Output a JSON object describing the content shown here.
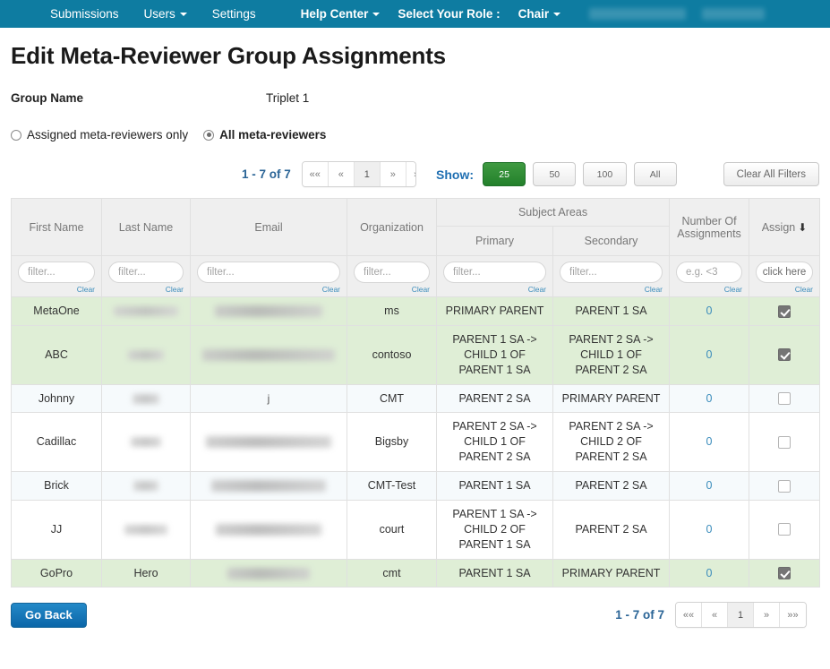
{
  "navbar": {
    "background": "#0e7ca1",
    "left_items": [
      {
        "label": "Submissions",
        "caret": false
      },
      {
        "label": "Users",
        "caret": true
      },
      {
        "label": "Settings",
        "caret": false
      }
    ],
    "help_center": "Help Center",
    "select_role_label": "Select Your Role :",
    "role_value": "Chair",
    "redacted_items": [
      "redacted-user-name",
      "redacted-conference"
    ]
  },
  "header": {
    "title": "Edit Meta-Reviewer Group Assignments",
    "group_name_label": "Group Name",
    "group_name_value": "Triplet 1"
  },
  "filter_mode": {
    "options": [
      {
        "label": "Assigned meta-reviewers only",
        "selected": false,
        "bold": false
      },
      {
        "label": "All meta-reviewers",
        "selected": true,
        "bold": true
      }
    ]
  },
  "toolbar": {
    "page_count": "1 - 7 of 7",
    "pager": [
      {
        "label": "««",
        "active": false
      },
      {
        "label": "«",
        "active": false
      },
      {
        "label": "1",
        "active": true
      },
      {
        "label": "»",
        "active": false
      },
      {
        "label": "»»",
        "active": false
      }
    ],
    "show_label": "Show:",
    "page_sizes": [
      {
        "label": "25",
        "active": true
      },
      {
        "label": "50",
        "active": false
      },
      {
        "label": "100",
        "active": false
      },
      {
        "label": "All",
        "active": false
      }
    ],
    "clear_all_filters": "Clear All Filters"
  },
  "table": {
    "headers": {
      "first_name": "First Name",
      "last_name": "Last Name",
      "email": "Email",
      "organization": "Organization",
      "subject_areas": "Subject Areas",
      "primary": "Primary",
      "secondary": "Secondary",
      "number_of_assignments": "Number Of Assignments",
      "assign": "Assign",
      "assign_sort_arrow": "⬇"
    },
    "filters": {
      "first_name_placeholder": "filter...",
      "last_name_placeholder": "filter...",
      "email_placeholder": "filter...",
      "organization_placeholder": "filter...",
      "primary_placeholder": "filter...",
      "secondary_placeholder": "filter...",
      "assignments_placeholder": "e.g. <3",
      "assign_button": "click here",
      "clear_label": "Clear"
    },
    "rows": [
      {
        "first_name": "MetaOne",
        "last_name": "",
        "last_name_redacted": true,
        "email": "",
        "email_redacted": true,
        "email_prefix": "",
        "organization": "ms",
        "primary": "PRIMARY PARENT",
        "secondary": "PARENT 1 SA",
        "assignments": "0",
        "assigned": true,
        "row_style": "assigned"
      },
      {
        "first_name": "ABC",
        "last_name": "",
        "last_name_redacted": true,
        "email": "",
        "email_redacted": true,
        "email_prefix": "",
        "organization": "contoso",
        "primary": "PARENT 1 SA -> CHILD 1 OF PARENT 1 SA",
        "secondary": "PARENT 2 SA -> CHILD 1 OF PARENT 2 SA",
        "assignments": "0",
        "assigned": true,
        "row_style": "assigned"
      },
      {
        "first_name": "Johnny",
        "last_name": "",
        "last_name_redacted": true,
        "email": "",
        "email_redacted": true,
        "email_prefix": "j",
        "organization": "CMT",
        "primary": "PARENT 2 SA",
        "secondary": "PRIMARY PARENT",
        "assignments": "0",
        "assigned": false,
        "row_style": "alt"
      },
      {
        "first_name": "Cadillac",
        "last_name": "",
        "last_name_redacted": true,
        "email": "",
        "email_redacted": true,
        "email_prefix": "",
        "organization": "Bigsby",
        "primary": "PARENT 2 SA -> CHILD 1 OF PARENT 2 SA",
        "secondary": "PARENT 2 SA -> CHILD 2 OF PARENT 2 SA",
        "assignments": "0",
        "assigned": false,
        "row_style": "plain"
      },
      {
        "first_name": "Brick",
        "last_name": "",
        "last_name_redacted": true,
        "email": "",
        "email_redacted": true,
        "email_prefix": "",
        "organization": "CMT-Test",
        "primary": "PARENT 1 SA",
        "secondary": "PARENT 2 SA",
        "assignments": "0",
        "assigned": false,
        "row_style": "alt"
      },
      {
        "first_name": "JJ",
        "last_name": "",
        "last_name_redacted": true,
        "email": "",
        "email_redacted": true,
        "email_prefix": "",
        "organization": "court",
        "primary": "PARENT 1 SA -> CHILD 2 OF PARENT 1 SA",
        "secondary": "PARENT 2 SA",
        "assignments": "0",
        "assigned": false,
        "row_style": "plain"
      },
      {
        "first_name": "GoPro",
        "last_name": "Hero",
        "last_name_redacted": false,
        "email": "",
        "email_redacted": true,
        "email_prefix": "",
        "organization": "cmt",
        "primary": "PARENT 1 SA",
        "secondary": "PRIMARY PARENT",
        "assignments": "0",
        "assigned": true,
        "row_style": "assigned"
      }
    ]
  },
  "footer": {
    "go_back": "Go Back",
    "page_count": "1 - 7 of 7",
    "pager": [
      {
        "label": "««",
        "active": false
      },
      {
        "label": "«",
        "active": false
      },
      {
        "label": "1",
        "active": true
      },
      {
        "label": "»",
        "active": false
      },
      {
        "label": "»»",
        "active": false
      }
    ]
  },
  "colors": {
    "navbar": "#0e7ca1",
    "assigned_row": "#dfeed6",
    "alt_row": "#f6fafc",
    "link": "#3c8dbc",
    "primary_button": "#0b66a8",
    "active_size": "#23802b"
  }
}
